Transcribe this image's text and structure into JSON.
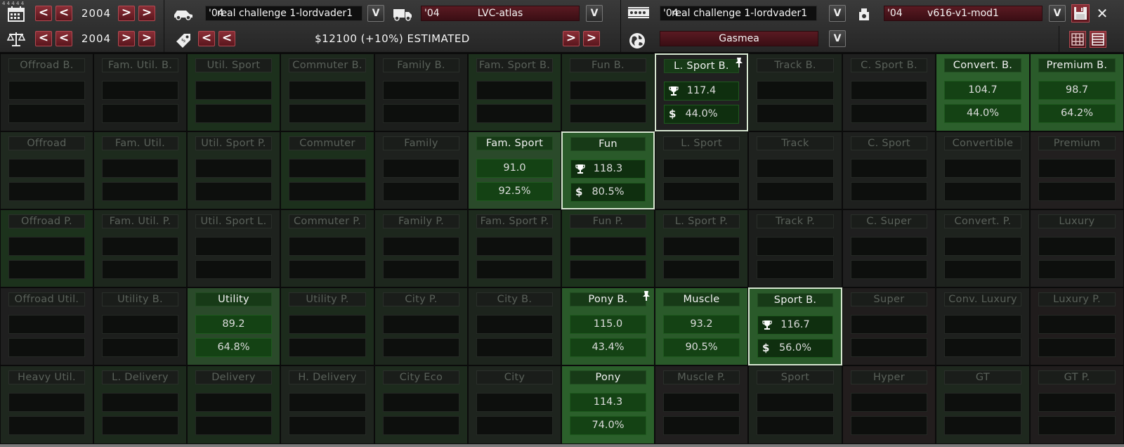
{
  "tiny_label": "4 4 4 4 4",
  "date_row": {
    "year": "2004"
  },
  "scale_row": {
    "year": "2004"
  },
  "car1": {
    "year": "'04",
    "name": "real challenge 1-lordvader1"
  },
  "car2": {
    "year": "'04",
    "name": "LVC-atlas"
  },
  "engine": {
    "year": "'04",
    "name": "real challenge 1-lordvader1"
  },
  "engine2": {
    "year": "'04",
    "name": "v616-v1-mod1"
  },
  "price": {
    "text": "$12100 (+10%) ESTIMATED"
  },
  "region": {
    "name": "Gasmea"
  },
  "buttons": {
    "prev": "<",
    "next": ">",
    "dropdown": "V",
    "close": "✕"
  },
  "colors": {
    "accent_red": "#8a2e36",
    "active_green": "#1e5a1e",
    "selection_border": "#d8e8d2"
  },
  "grid": {
    "rows": [
      [
        {
          "name": "Offroad B."
        },
        {
          "name": "Fam. Util. B."
        },
        {
          "name": "Util. Sport"
        },
        {
          "name": "Commuter B."
        },
        {
          "name": "Family B."
        },
        {
          "name": "Fam. Sport B."
        },
        {
          "name": "Fun B."
        },
        {
          "name": "L. Sport B.",
          "active": true,
          "selected": true,
          "pinned": true,
          "v1": "117.4",
          "v2": "44.0%"
        },
        {
          "name": "Track B."
        },
        {
          "name": "C. Sport B."
        },
        {
          "name": "Convert. B.",
          "active": true,
          "v1": "104.7",
          "v2": "44.0%"
        },
        {
          "name": "Premium B.",
          "active": true,
          "v1": "98.7",
          "v2": "64.2%"
        }
      ],
      [
        {
          "name": "Offroad"
        },
        {
          "name": "Fam. Util."
        },
        {
          "name": "Util. Sport P."
        },
        {
          "name": "Commuter"
        },
        {
          "name": "Family"
        },
        {
          "name": "Fam. Sport",
          "active": true,
          "v1": "91.0",
          "v2": "92.5%"
        },
        {
          "name": "Fun",
          "active": true,
          "selected": true,
          "v1": "118.3",
          "v2": "80.5%"
        },
        {
          "name": "L. Sport"
        },
        {
          "name": "Track"
        },
        {
          "name": "C. Sport"
        },
        {
          "name": "Convertible"
        },
        {
          "name": "Premium"
        }
      ],
      [
        {
          "name": "Offroad P."
        },
        {
          "name": "Fam. Util. P."
        },
        {
          "name": "Util. Sport L."
        },
        {
          "name": "Commuter P."
        },
        {
          "name": "Family P."
        },
        {
          "name": "Fam. Sport P."
        },
        {
          "name": "Fun P."
        },
        {
          "name": "L. Sport P."
        },
        {
          "name": "Track P."
        },
        {
          "name": "C. Super"
        },
        {
          "name": "Convert. P."
        },
        {
          "name": "Luxury"
        }
      ],
      [
        {
          "name": "Offroad Util."
        },
        {
          "name": "Utility B."
        },
        {
          "name": "Utility",
          "active": true,
          "v1": "89.2",
          "v2": "64.8%"
        },
        {
          "name": "Utility P."
        },
        {
          "name": "City P."
        },
        {
          "name": "City B."
        },
        {
          "name": "Pony B.",
          "active": true,
          "pinned": true,
          "v1": "115.0",
          "v2": "43.4%"
        },
        {
          "name": "Muscle",
          "active": true,
          "v1": "93.2",
          "v2": "90.5%"
        },
        {
          "name": "Sport B.",
          "active": true,
          "selected": true,
          "v1": "116.7",
          "v2": "56.0%"
        },
        {
          "name": "Super"
        },
        {
          "name": "Conv. Luxury"
        },
        {
          "name": "Luxury P."
        }
      ],
      [
        {
          "name": "Heavy Util."
        },
        {
          "name": "L. Delivery"
        },
        {
          "name": "Delivery"
        },
        {
          "name": "H. Delivery"
        },
        {
          "name": "City Eco"
        },
        {
          "name": "City"
        },
        {
          "name": "Pony",
          "active": true,
          "v1": "114.3",
          "v2": "74.0%"
        },
        {
          "name": "Muscle P."
        },
        {
          "name": "Sport"
        },
        {
          "name": "Hyper"
        },
        {
          "name": "GT"
        },
        {
          "name": "GT P."
        }
      ]
    ]
  }
}
